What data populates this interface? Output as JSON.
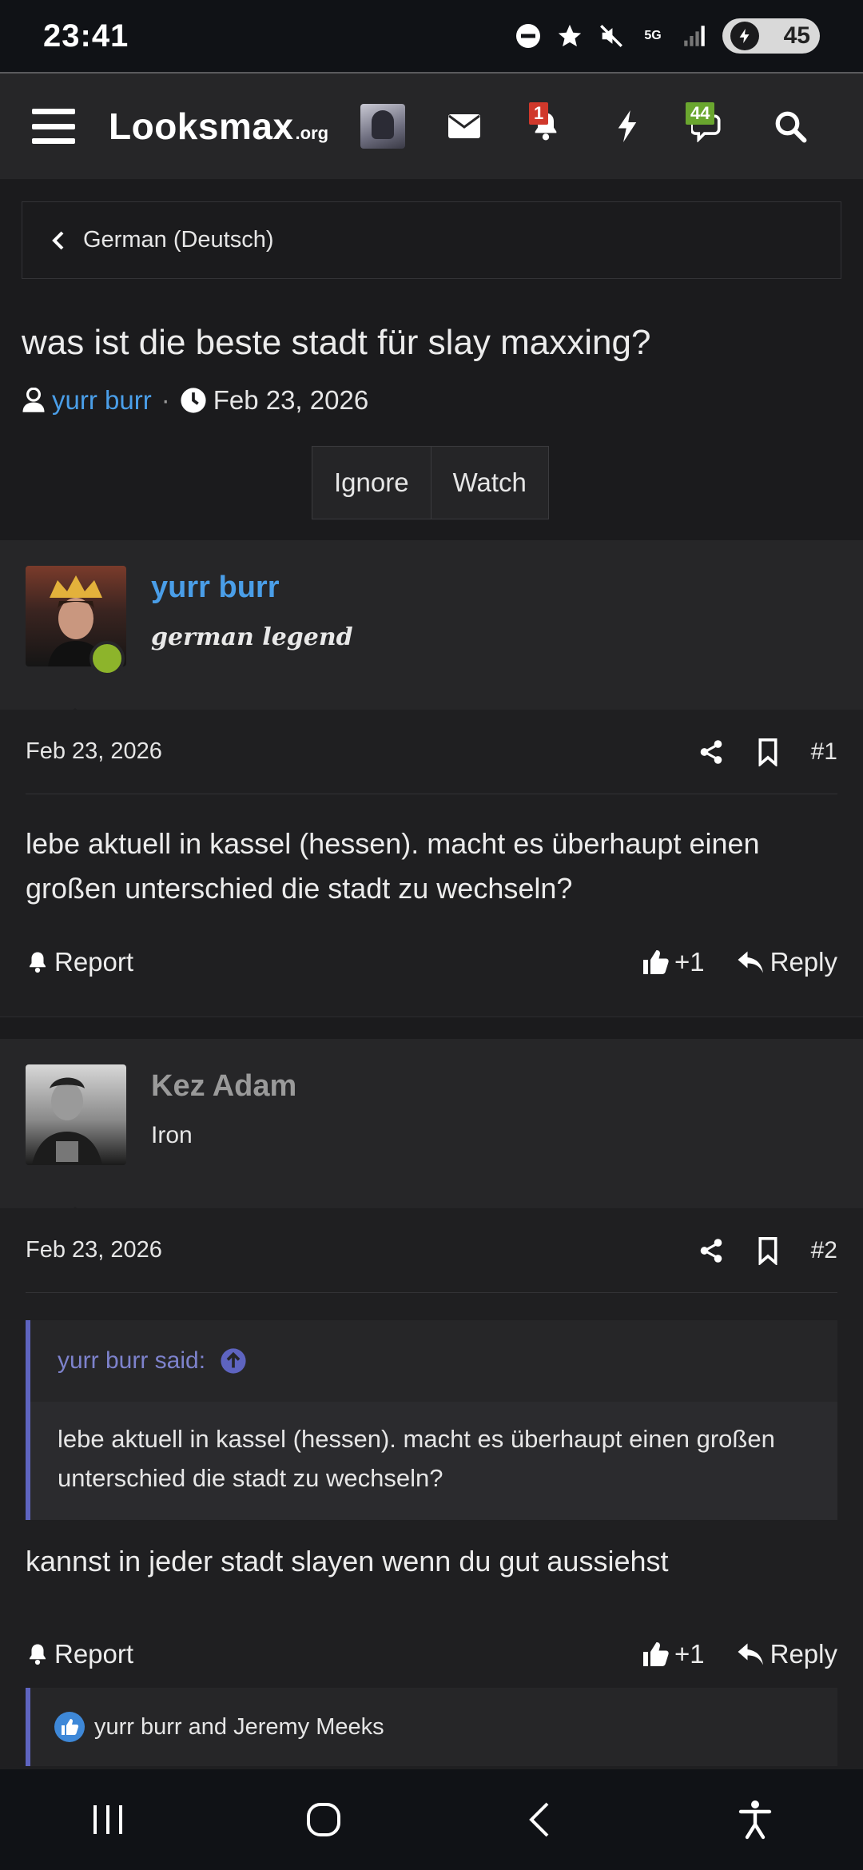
{
  "status_bar": {
    "time": "23:41",
    "network": "5G",
    "battery": "45",
    "icons": [
      "dnd-icon",
      "star-icon",
      "mute-icon",
      "5g-icon",
      "signal-icon",
      "battery-icon"
    ]
  },
  "header": {
    "logo_main": "Looksmax",
    "logo_suffix": ".org",
    "alerts_badge": "1",
    "conversations_badge": "44",
    "icons": [
      "menu-icon",
      "avatar",
      "mail-icon",
      "bell-icon",
      "bolt-icon",
      "chat-icon",
      "search-icon"
    ]
  },
  "breadcrumb": {
    "label": "German (Deutsch)"
  },
  "thread": {
    "title": "was ist die beste stadt für slay maxxing?",
    "author": "yurr burr",
    "separator": "·",
    "date": "Feb 23, 2026",
    "buttons": {
      "ignore": "Ignore",
      "watch": "Watch"
    }
  },
  "posts": [
    {
      "user": "yurr burr",
      "user_title": "german legend",
      "user_color": "#4a9ee8",
      "date": "Feb 23, 2026",
      "number": "#1",
      "text": "lebe aktuell in kassel (hessen). macht es überhaupt einen großen unterschied die stadt zu wechseln?",
      "report": "Report",
      "likes": "+1",
      "reply": "Reply"
    },
    {
      "user": "Kez Adam",
      "user_title": "Iron",
      "user_color": "#9a9a9a",
      "date": "Feb 23, 2026",
      "number": "#2",
      "quote_author": "yurr burr said:",
      "quote_text": "lebe aktuell in kassel (hessen). macht es überhaupt einen großen unterschied die stadt zu wechseln?",
      "text": "kannst in jeder stadt slayen wenn du gut aussiehst",
      "report": "Report",
      "likes": "+1",
      "reply": "Reply",
      "reactions": "yurr burr and Jeremy Meeks"
    }
  ],
  "colors": {
    "accent_link": "#4a9ee8",
    "quote_border": "#5e64c0",
    "online": "#8db42b",
    "badge_red": "#d0382b",
    "badge_green": "#6aa62f"
  }
}
